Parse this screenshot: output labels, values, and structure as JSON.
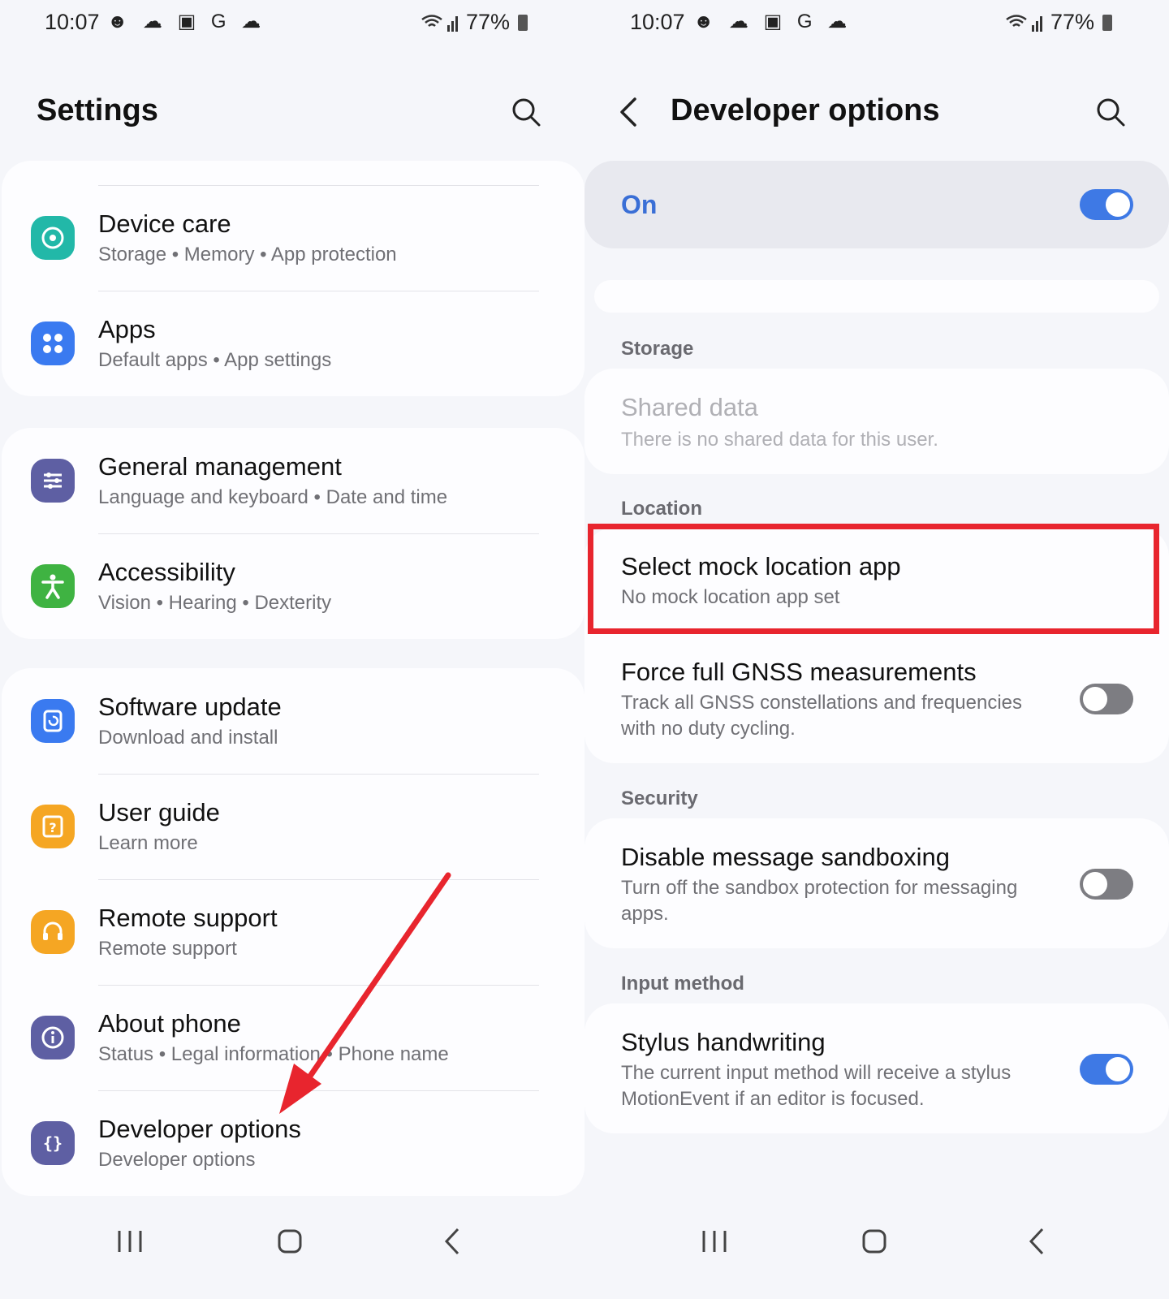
{
  "status": {
    "time": "10:07",
    "notifications": "☻ ☁ ▣ G ☁",
    "signal": "wifi-signal",
    "battery": "77%"
  },
  "left": {
    "title": "Settings",
    "items": [
      {
        "title": "Device care",
        "sub": "Storage  •  Memory  •  App protection",
        "icon": "device-care-icon",
        "color": "#22b8a8"
      },
      {
        "title": "Apps",
        "sub": "Default apps  •  App settings",
        "icon": "apps-icon",
        "color": "#3a7af0"
      },
      {
        "title": "General management",
        "sub": "Language and keyboard  •  Date and time",
        "icon": "general-management-icon",
        "color": "#5e5fa3"
      },
      {
        "title": "Accessibility",
        "sub": "Vision  •  Hearing  •  Dexterity",
        "icon": "accessibility-icon",
        "color": "#3fb342"
      },
      {
        "title": "Software update",
        "sub": "Download and install",
        "icon": "software-update-icon",
        "color": "#3a7af0"
      },
      {
        "title": "User guide",
        "sub": "Learn more",
        "icon": "user-guide-icon",
        "color": "#f5a623"
      },
      {
        "title": "Remote support",
        "sub": "Remote support",
        "icon": "headset-icon",
        "color": "#f5a623"
      },
      {
        "title": "About phone",
        "sub": "Status  •  Legal information  •  Phone name",
        "icon": "info-icon",
        "color": "#5e5fa3"
      },
      {
        "title": "Developer options",
        "sub": "Developer options",
        "icon": "developer-braces-icon",
        "color": "#5e5fa3"
      }
    ]
  },
  "right": {
    "title": "Developer options",
    "master": {
      "label": "On",
      "state": "on"
    },
    "sections": {
      "storage": "Storage",
      "location": "Location",
      "security": "Security",
      "input": "Input method"
    },
    "shared": {
      "title": "Shared data",
      "sub": "There is no shared data for this user."
    },
    "mock": {
      "title": "Select mock location app",
      "sub": "No mock location app set"
    },
    "gnss": {
      "title": "Force full GNSS measurements",
      "sub": "Track all GNSS constellations and frequencies with no duty cycling.",
      "state": "off"
    },
    "sandbox": {
      "title": "Disable message sandboxing",
      "sub": "Turn off the sandbox protection for messaging apps.",
      "state": "off"
    },
    "stylus": {
      "title": "Stylus handwriting",
      "sub": "The current input method will receive a stylus MotionEvent if an editor is focused.",
      "state": "on"
    }
  },
  "colors": {
    "accent": "#3e79e5",
    "highlight": "#e8252e",
    "arrow": "#e8252e"
  }
}
